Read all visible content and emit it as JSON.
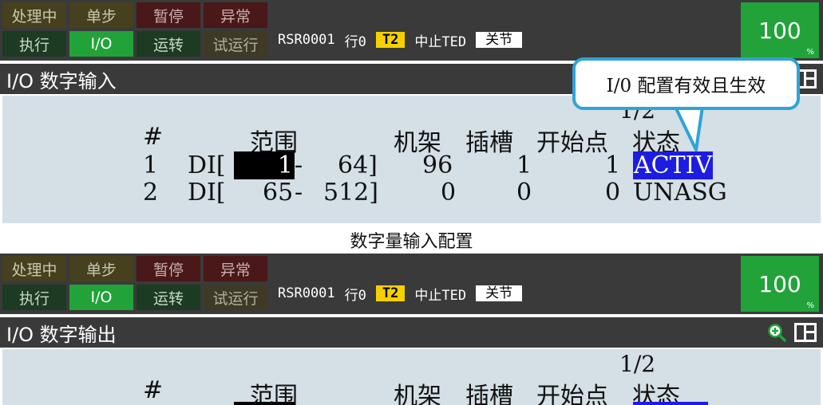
{
  "status_buttons": [
    "处理中",
    "单步",
    "暂停",
    "异常",
    "执行",
    "I/O",
    "运转",
    "试运行"
  ],
  "status_line": {
    "program": "RSR0001",
    "line": "行0",
    "mode": "T2",
    "state": "中止TED",
    "coord": "关节"
  },
  "override": {
    "value": "100",
    "unit": "%"
  },
  "input_screen": {
    "title": "I/O 数字输入",
    "page": "1/2",
    "headers": {
      "num": "#",
      "range": "范围",
      "rack": "机架",
      "slot": "插槽",
      "start": "开始点",
      "status": "状态"
    },
    "rows": [
      {
        "num": "1",
        "type": "DI[",
        "start_idx": "1",
        "sep": "-",
        "end_idx": "64]",
        "rack": "96",
        "slot": "1",
        "start": "1",
        "status": "ACTIV"
      },
      {
        "num": "2",
        "type": "DI[",
        "start_idx": "65",
        "sep": "-",
        "end_idx": "512]",
        "rack": "0",
        "slot": "0",
        "start": "0",
        "status": "UNASG"
      }
    ]
  },
  "callout_text": "I/0 配置有效且生效",
  "caption": "数字量输入配置",
  "output_screen": {
    "title": "I/O 数字输出",
    "page": "1/2",
    "headers": {
      "num": "#",
      "range": "范围",
      "rack": "机架",
      "slot": "插槽",
      "start": "开始点",
      "status": "状态"
    }
  },
  "colors": {
    "status_active_green": "#22a33a",
    "mode_badge_yellow": "#f5d000",
    "selection_blue": "#1d1de0",
    "callout_border": "#2fa3d6",
    "content_bg": "#d4dfe6"
  }
}
